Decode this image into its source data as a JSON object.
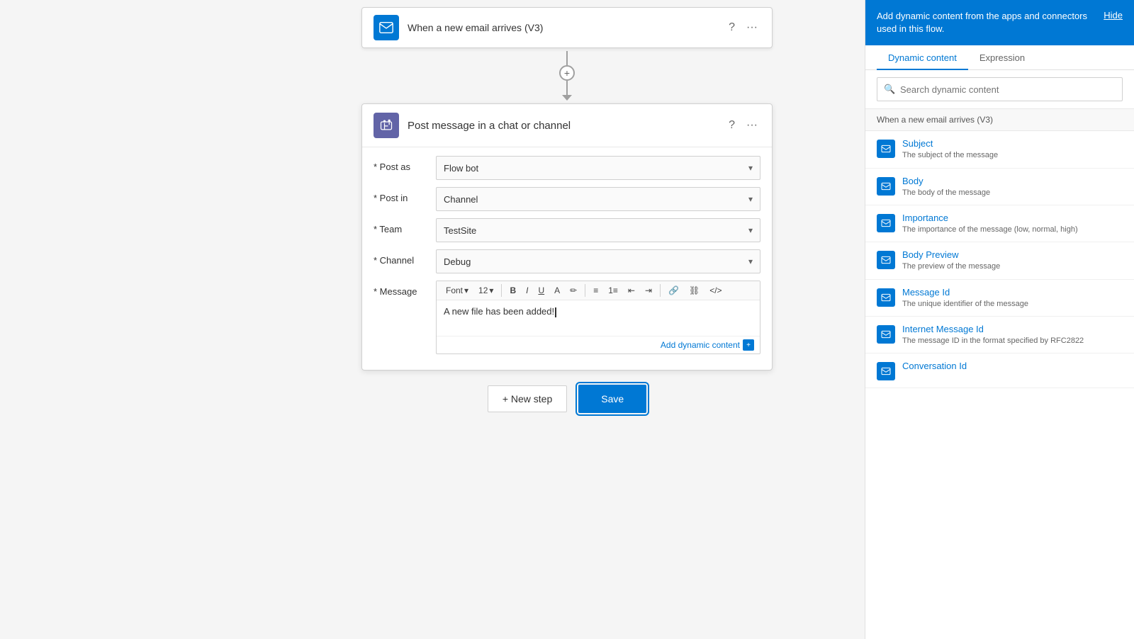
{
  "top_connector": {
    "title": "When a new email arrives (V3)",
    "icon": "envelope"
  },
  "action_card": {
    "title": "Post message in a chat or channel",
    "icon": "teams"
  },
  "form": {
    "post_as_label": "* Post as",
    "post_as_value": "Flow bot",
    "post_in_label": "* Post in",
    "post_in_value": "Channel",
    "team_label": "* Team",
    "team_value": "TestSite",
    "channel_label": "* Channel",
    "channel_value": "Debug",
    "message_label": "* Message",
    "font_label": "Font",
    "font_size": "12",
    "message_text": "A new file has been added!",
    "add_dynamic_label": "Add dynamic content",
    "toolbar_buttons": [
      "B",
      "I",
      "U"
    ]
  },
  "bottom_actions": {
    "new_step_label": "+ New step",
    "save_label": "Save"
  },
  "dynamic_panel": {
    "header_text": "Add dynamic content from the apps and connectors used in this flow.",
    "hide_label": "Hide",
    "tabs": [
      "Dynamic content",
      "Expression"
    ],
    "active_tab": "Dynamic content",
    "search_placeholder": "Search dynamic content",
    "section_header": "When a new email arrives (V3)",
    "items": [
      {
        "name": "Subject",
        "description": "The subject of the message"
      },
      {
        "name": "Body",
        "description": "The body of the message"
      },
      {
        "name": "Importance",
        "description": "The importance of the message (low, normal, high)"
      },
      {
        "name": "Body Preview",
        "description": "The preview of the message"
      },
      {
        "name": "Message Id",
        "description": "The unique identifier of the message"
      },
      {
        "name": "Internet Message Id",
        "description": "The message ID in the format specified by RFC2822"
      },
      {
        "name": "Conversation Id",
        "description": ""
      }
    ]
  }
}
